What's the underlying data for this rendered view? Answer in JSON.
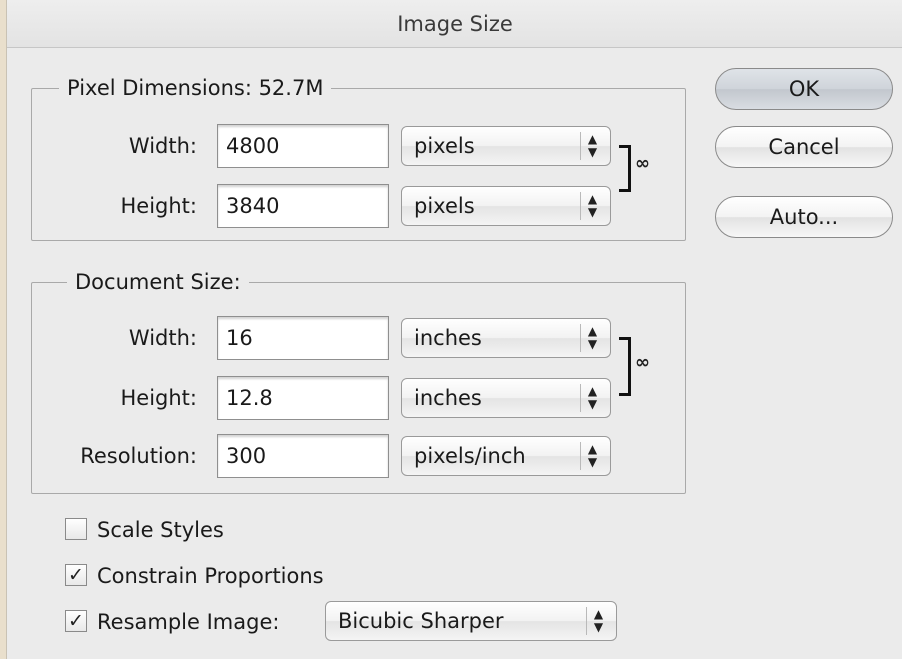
{
  "dialog": {
    "title": "Image Size"
  },
  "pixel_dimensions": {
    "legend": "Pixel Dimensions:  52.7M",
    "width_label": "Width:",
    "width_value": "4800",
    "width_unit": "pixels",
    "height_label": "Height:",
    "height_value": "3840",
    "height_unit": "pixels"
  },
  "document_size": {
    "legend": "Document Size:",
    "width_label": "Width:",
    "width_value": "16",
    "width_unit": "inches",
    "height_label": "Height:",
    "height_value": "12.8",
    "height_unit": "inches",
    "resolution_label": "Resolution:",
    "resolution_value": "300",
    "resolution_unit": "pixels/inch"
  },
  "buttons": {
    "ok": "OK",
    "cancel": "Cancel",
    "auto": "Auto..."
  },
  "options": {
    "scale_styles": {
      "label": "Scale Styles",
      "checked": false
    },
    "constrain_proportions": {
      "label": "Constrain Proportions",
      "checked": true
    },
    "resample_image": {
      "label": "Resample Image:",
      "checked": true,
      "method": "Bicubic Sharper"
    }
  },
  "icons": {
    "stepper": "up-down-arrows-icon",
    "link": "chain-link-icon",
    "check": "checkmark-icon"
  }
}
